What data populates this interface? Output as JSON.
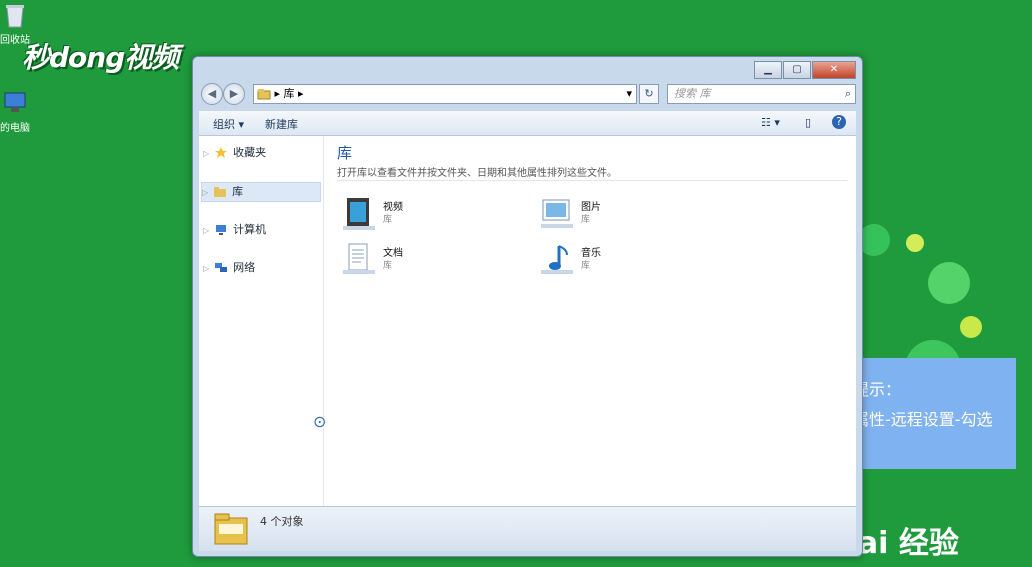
{
  "desktop": {
    "icons": [
      {
        "label": "回收站",
        "icon": "recycle-bin-icon"
      },
      {
        "label": "的电脑",
        "icon": "computer-icon"
      }
    ],
    "brand_text": "秒dong视频",
    "tip": {
      "title": "小提示：",
      "body": "计算机属性-远程设置-勾选"
    },
    "baidu_text": "Bai 经验"
  },
  "window": {
    "caption_buttons": {
      "minimize": "▁",
      "maximize": "▢",
      "close": "✕"
    },
    "address": {
      "root_arrow": "▸",
      "path": "库",
      "path_arrow": "▸",
      "dropdown": "▾"
    },
    "refresh_label": "↻",
    "search": {
      "placeholder": "搜索 库",
      "icon": "search-icon"
    },
    "toolbar": {
      "organize": "组织 ▾",
      "new_library": "新建库",
      "views": "☷ ▾",
      "preview_pane": "▯",
      "help": "?"
    },
    "nav": [
      {
        "label": "收藏夹",
        "icon": "star-icon",
        "selected": false
      },
      {
        "label": "库",
        "icon": "library-icon",
        "selected": true
      },
      {
        "label": "计算机",
        "icon": "computer-icon",
        "selected": false
      },
      {
        "label": "网络",
        "icon": "network-icon",
        "selected": false
      }
    ],
    "main": {
      "title": "库",
      "description": "打开库以查看文件并按文件夹、日期和其他属性排列这些文件。",
      "items": [
        {
          "name": "视频",
          "sub": "库",
          "icon": "video-library-icon"
        },
        {
          "name": "图片",
          "sub": "库",
          "icon": "pictures-library-icon"
        },
        {
          "name": "文档",
          "sub": "库",
          "icon": "documents-library-icon"
        },
        {
          "name": "音乐",
          "sub": "库",
          "icon": "music-library-icon"
        }
      ]
    },
    "status": {
      "count": "4 个对象"
    }
  }
}
